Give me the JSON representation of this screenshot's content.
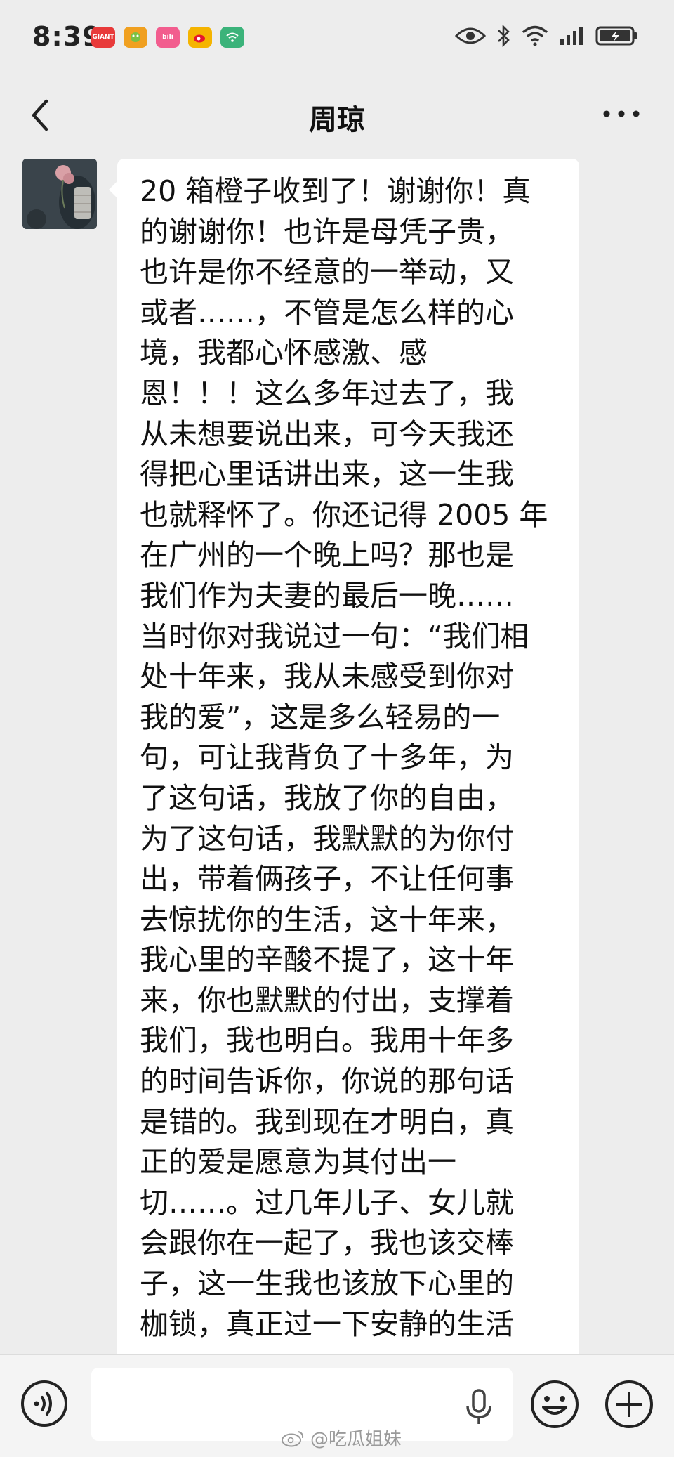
{
  "status_bar": {
    "time": "8:39",
    "app_icons": [
      {
        "name": "giant-app-icon",
        "color": "#e83a3a",
        "label": "GIANT"
      },
      {
        "name": "game-app-icon",
        "color": "#f0a020",
        "label": ""
      },
      {
        "name": "bilibili-app-icon",
        "color": "#f25d8e",
        "label": "bilibili"
      },
      {
        "name": "weibo-app-icon",
        "color": "#f5b400",
        "label": ""
      },
      {
        "name": "wifi-app-icon",
        "color": "#3bb37a",
        "label": ""
      }
    ],
    "battery_charging": true
  },
  "nav": {
    "title": "周琼"
  },
  "message": {
    "text": "20 箱橙子收到了！谢谢你！真的谢谢你！也许是母凭子贵，也许是你不经意的一举动，又或者……，不管是怎么样的心境，我都心怀感激、感恩！！！这么多年过去了，我从未想要说出来，可今天我还得把心里话讲出来，这一生我也就释怀了。你还记得 2005 年在广州的一个晚上吗？那也是我们作为夫妻的最后一晚……当时你对我说过一句：“我们相处十年来，我从未感受到你对我的爱”，这是多么轻易的一句，可让我背负了十多年，为了这句话，我放了你的自由，为了这句话，我默默的为你付出，带着俩孩子，不让任何事去惊扰你的生活，这十年来，我心里的辛酸不提了，这十年来，你也默默的付出，支撑着我们，我也明白。我用十年多的时间告诉你，你说的那句话是错的。我到现在才明白，真正的爱是愿意为其付出一切……。过几年儿子、女儿就会跟你在一起了，我也该交棒子，这一生我也该放下心里的枷锁，真正过一下安静的生活",
    "lines": [
      "20 箱橙子收到了！谢谢你！真",
      "的谢谢你！也许是母凭子贵，",
      "也许是你不经意的一举动，又",
      "或者……，不管是怎么样的心",
      "境，我都心怀感激、感",
      "恩！！！这么多年过去了，我",
      "从未想要说出来，可今天我还",
      "得把心里话讲出来，这一生我",
      "也就释怀了。你还记得 2005 年",
      "在广州的一个晚上吗？那也是",
      "我们作为夫妻的最后一晚……",
      "当时你对我说过一句：“我们相",
      "处十年来，我从未感受到你对",
      "我的爱”，这是多么轻易的一",
      "句，可让我背负了十多年，为",
      "了这句话，我放了你的自由，",
      "为了这句话，我默默的为你付",
      "出，带着俩孩子，不让任何事",
      "去惊扰你的生活，这十年来，",
      "我心里的辛酸不提了，这十年",
      "来，你也默默的付出，支撑着",
      "我们，我也明白。我用十年多",
      "的时间告诉你，你说的那句话",
      "是错的。我到现在才明白，真",
      "正的爱是愿意为其付出一",
      "切……。过几年儿子、女儿就",
      "会跟你在一起了，我也该交棒",
      "子，这一生我也该放下心里的",
      "枷锁，真正过一下安静的生活"
    ]
  },
  "watermark": {
    "text": "@吃瓜姐妹"
  },
  "colors": {
    "background": "#ededed",
    "bubble": "#ffffff",
    "text": "#111111"
  }
}
